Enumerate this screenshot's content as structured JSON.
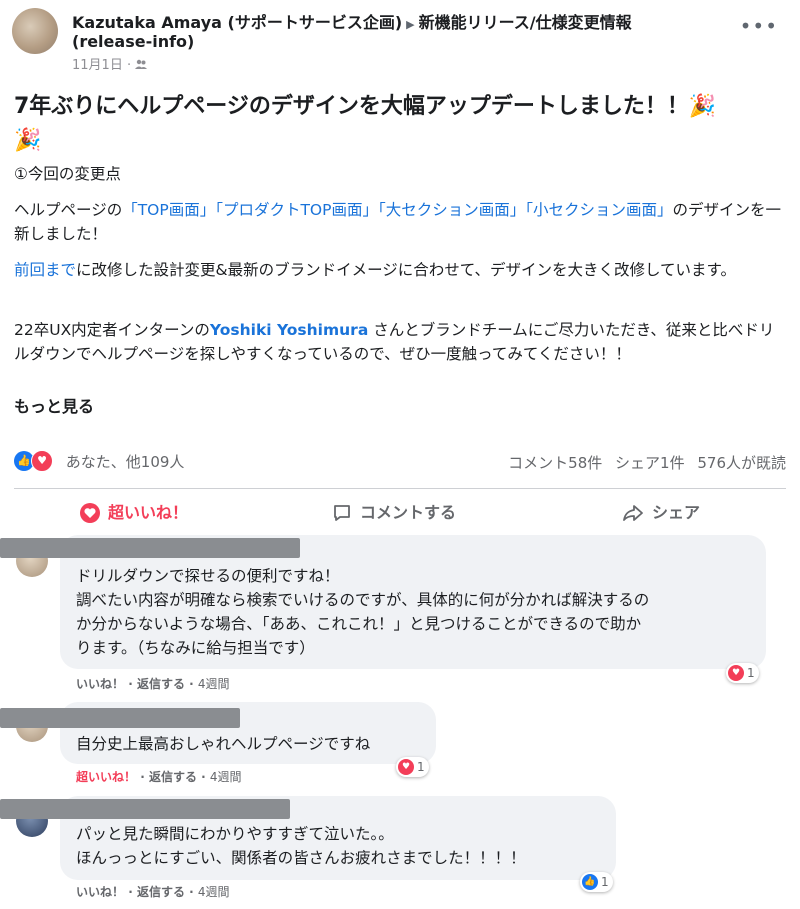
{
  "post": {
    "author": "Kazutaka Amaya (サポートサービス企画)",
    "group": "新機能リリース/仕様変更情報",
    "group_slug": "(release-info)",
    "date": "11月1日",
    "audience_icon": "group-icon",
    "title": "7年ぶりにヘルプページのデザインを大幅アップデートしました！！🎉",
    "title_emoji_2": "🎉",
    "section_heading": "①今回の変更点",
    "para1_pre": "ヘルプページの",
    "para1_links": [
      "「TOP画面」",
      "「プロダクトTOP画面」",
      "「大セクション画面」",
      "「小セクション画面」"
    ],
    "para1_post": "のデザインを一新しました！",
    "para2_link": "前回まで",
    "para2_text": "に改修した設計変更&最新のブランドイメージに合わせて、デザインを大きく改修しています。",
    "para3_pre": "22卒UX内定者インターンの",
    "para3_mention": "Yoshiki Yoshimura",
    "para3_post": " さんとブランドチームにご尽力いただき、従来と比べドリルダウンでヘルプページを探しやすくなっているので、ぜひ一度触ってみてください！！",
    "see_more": "もっと見る"
  },
  "reactions": {
    "names": "あなた、他109人",
    "comments": "コメント58件",
    "shares": "シェア1件",
    "views": "576人が既読"
  },
  "actions": {
    "love": "超いいね！",
    "comment": "コメントする",
    "share": "シェア"
  },
  "comments": [
    {
      "text_lines": [
        "ドリルダウンで探せるの便利ですね！",
        "調べたい内容が明確なら検索でいけるのですが、具体的に何が分かれば解決するの",
        "か分からないような場合、「ああ、これこれ！」と見つけることができるので助か",
        "ります。（ちなみに給与担当です）"
      ],
      "like": "いいね！",
      "reply": "返信する",
      "time": "4週間",
      "reaction_count": "1",
      "reaction_type": "heart"
    },
    {
      "text_lines": [
        "自分史上最高おしゃれヘルプページですね"
      ],
      "like": "超いいね！",
      "reply": "返信する",
      "time": "4週間",
      "reaction_count": "1",
      "reaction_type": "heart"
    },
    {
      "text_lines": [
        "パッと見た瞬間にわかりやすすぎて泣いた。。",
        "ほんっっとにすごい、関係者の皆さんお疲れさまでした！！！！"
      ],
      "like": "いいね！",
      "reply": "返信する",
      "time": "4週間",
      "reaction_count": "1",
      "reaction_type": "like"
    }
  ],
  "colors": {
    "link": "#1a73d9",
    "love": "#f33e58",
    "like": "#1877f2"
  }
}
